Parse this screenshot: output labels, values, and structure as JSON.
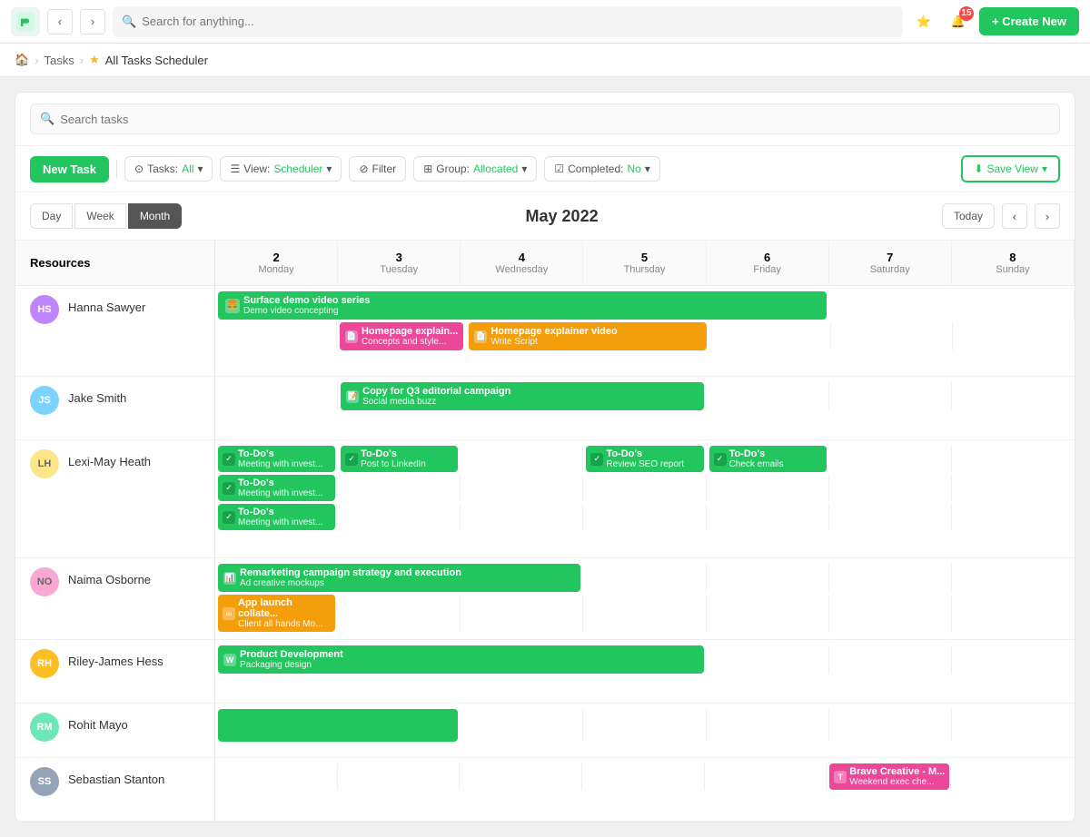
{
  "app": {
    "logo_text": "P",
    "search_placeholder": "Search for anything...",
    "notification_count": "15",
    "create_btn": "+ Create New"
  },
  "breadcrumb": {
    "home_icon": "🏠",
    "tasks": "Tasks",
    "separator": ">",
    "star": "★",
    "current": "All Tasks Scheduler"
  },
  "toolbar": {
    "search_placeholder": "Search tasks",
    "new_task": "New Task",
    "tasks_label": "Tasks:",
    "tasks_value": "All",
    "view_label": "View:",
    "view_value": "Scheduler",
    "filter": "Filter",
    "group_label": "Group:",
    "group_value": "Allocated",
    "completed_label": "Completed:",
    "completed_value": "No",
    "save_view": "Save View"
  },
  "calendar": {
    "view_tabs": [
      "Day",
      "Week",
      "Month"
    ],
    "active_tab": "Month",
    "title": "May 2022",
    "today_btn": "Today",
    "days": [
      {
        "num": "2",
        "name": "Monday"
      },
      {
        "num": "3",
        "name": "Tuesday"
      },
      {
        "num": "4",
        "name": "Wednesday"
      },
      {
        "num": "5",
        "name": "Thursday"
      },
      {
        "num": "6",
        "name": "Friday"
      },
      {
        "num": "7",
        "name": "Saturday"
      },
      {
        "num": "8",
        "name": "Sunday"
      }
    ],
    "resources_label": "Resources"
  },
  "resources": [
    {
      "name": "Hanna Sawyer",
      "avatar_color": "#c084fc",
      "initials": "HS",
      "rows": [
        {
          "tasks": [
            {
              "col_start": 0,
              "col_span": 5,
              "color": "green",
              "icon": "🍔",
              "title": "Surface demo video series",
              "sub": "Demo video concepting"
            },
            {
              "col_start": 1,
              "col_span": 1,
              "color": "pink",
              "icon": "📄",
              "title": "Homepage explain...",
              "sub": "Concepts and style..."
            },
            {
              "col_start": 2,
              "col_span": 2,
              "color": "orange",
              "icon": "📄",
              "title": "Homepage explainer video",
              "sub": "Write Script"
            }
          ]
        }
      ]
    },
    {
      "name": "Jake Smith",
      "avatar_color": "#86efac",
      "initials": "JS",
      "rows": [
        {
          "tasks": [
            {
              "col_start": 1,
              "col_span": 3,
              "color": "green",
              "icon": "📝",
              "title": "Copy for Q3 editorial campaign",
              "sub": "Social media buzz"
            }
          ]
        }
      ]
    },
    {
      "name": "Lexi-May Heath",
      "avatar_color": "#fde68a",
      "initials": "LH",
      "rows": [
        {
          "tasks": [
            {
              "col_start": 0,
              "col_span": 1,
              "color": "green",
              "icon": "✓",
              "title": "To-Do's",
              "sub": "Meeting with invest...",
              "is_todo": true
            },
            {
              "col_start": 1,
              "col_span": 1,
              "color": "green",
              "icon": "✓",
              "title": "To-Do's",
              "sub": "Post to LinkedIn",
              "is_todo": true
            },
            {
              "col_start": 3,
              "col_span": 1,
              "color": "green",
              "icon": "✓",
              "title": "To-Do's",
              "sub": "Review SEO report",
              "is_todo": true
            },
            {
              "col_start": 4,
              "col_span": 1,
              "color": "green",
              "icon": "✓",
              "title": "To-Do's",
              "sub": "Check emails",
              "is_todo": true
            }
          ]
        },
        {
          "tasks": [
            {
              "col_start": 0,
              "col_span": 1,
              "color": "green",
              "icon": "✓",
              "title": "To-Do's",
              "sub": "Meeting with invest...",
              "is_todo": true
            }
          ]
        },
        {
          "tasks": [
            {
              "col_start": 0,
              "col_span": 1,
              "color": "green",
              "icon": "✓",
              "title": "To-Do's",
              "sub": "Meeting with invest...",
              "is_todo": true
            }
          ]
        }
      ]
    },
    {
      "name": "Naima Osborne",
      "avatar_color": "#f9a8d4",
      "initials": "NO",
      "rows": [
        {
          "tasks": [
            {
              "col_start": 0,
              "col_span": 3,
              "color": "green",
              "icon": "📊",
              "title": "Remarketing campaign strategy and execution",
              "sub": "Ad creative mockups"
            }
          ]
        },
        {
          "tasks": [
            {
              "col_start": 0,
              "col_span": 1,
              "color": "orange",
              "icon": "∞",
              "title": "App launch collate...",
              "sub": "Client all hands Mo..."
            }
          ]
        }
      ]
    },
    {
      "name": "Riley-James Hess",
      "avatar_color": "#fbbf24",
      "initials": "RH",
      "rows": [
        {
          "tasks": [
            {
              "col_start": 0,
              "col_span": 4,
              "color": "green",
              "icon": "W",
              "title": "Product Development",
              "sub": "Packaging design"
            }
          ]
        }
      ]
    },
    {
      "name": "Rohit Mayo",
      "avatar_color": "#6ee7b7",
      "initials": "RM",
      "rows": [
        {
          "tasks": [
            {
              "col_start": 0,
              "col_span": 2,
              "color": "green",
              "icon": "",
              "title": "",
              "sub": ""
            }
          ]
        }
      ]
    },
    {
      "name": "Sebastian Stanton",
      "avatar_color": "#94a3b8",
      "initials": "SS",
      "rows": [
        {
          "tasks": [
            {
              "col_start": 5,
              "col_span": 1,
              "color": "pink",
              "icon": "T",
              "title": "Brave Creative - M...",
              "sub": "Weekend exec che..."
            }
          ]
        }
      ]
    }
  ]
}
